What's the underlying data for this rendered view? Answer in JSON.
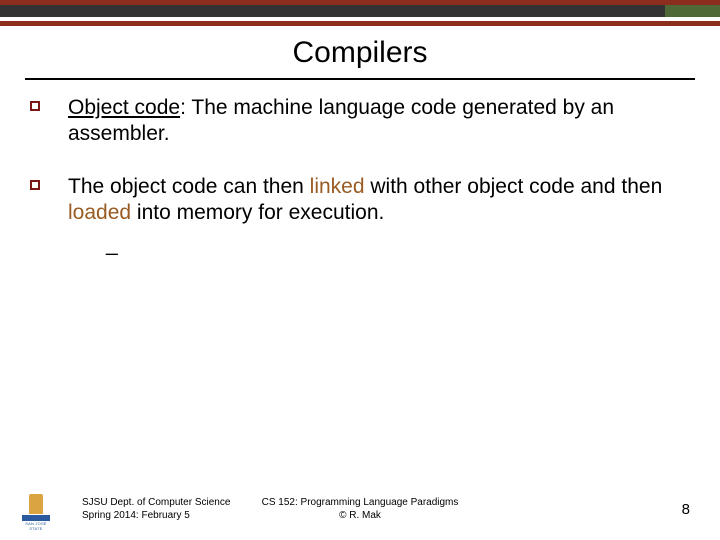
{
  "title": "Compilers",
  "bullets": [
    {
      "term": "Object code",
      "rest": ": The machine language code generated by an assembler."
    },
    {
      "pre": "The object code can then ",
      "link1": "linked",
      "mid": " with other object code and then ",
      "link2": "loaded",
      "post": " into memory for execution."
    }
  ],
  "sub_dash": "_",
  "footer": {
    "dept_line1": "SJSU Dept. of Computer Science",
    "dept_line2": "Spring 2014: February 5",
    "course_line1": "CS 152: Programming Language Paradigms",
    "course_line2": "© R. Mak",
    "page": "8",
    "logo_text": "SAN JOSÉ STATE"
  }
}
